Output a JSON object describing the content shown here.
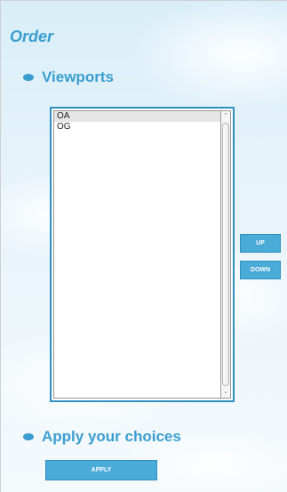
{
  "order": {
    "title": "Order"
  },
  "viewports": {
    "heading": "Viewports",
    "options": [
      "OA",
      "OG"
    ],
    "selected": "OA"
  },
  "reorder": {
    "up_label": "UP",
    "down_label": "DOWN"
  },
  "apply_section": {
    "heading": "Apply your choices",
    "button_label": "APPLY"
  },
  "icons": {
    "bullet": "bullet-icon",
    "scroll_up": "scroll-up-arrow-icon",
    "scroll_down": "scroll-down-arrow-icon"
  },
  "colors": {
    "accent": "#3a9ed0",
    "button_bg": "#4aaad8",
    "list_border": "#2f8fbf"
  }
}
